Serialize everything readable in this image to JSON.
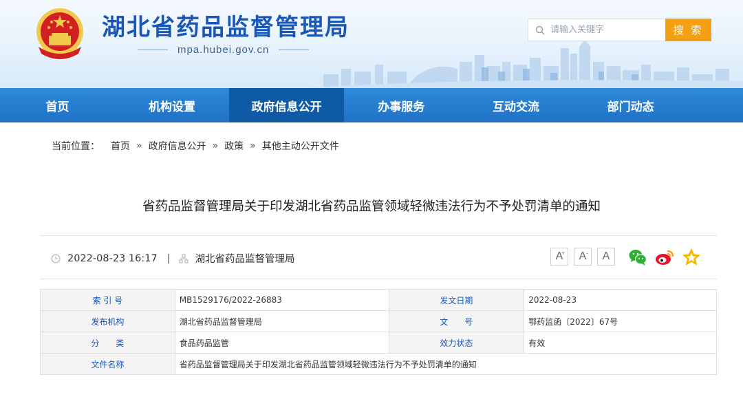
{
  "header": {
    "site_title": "湖北省药品监督管理局",
    "domain": "mpa.hubei.gov.cn",
    "search_placeholder": "请输入关键字",
    "search_button": "搜 索"
  },
  "nav": {
    "items": [
      {
        "label": "首页"
      },
      {
        "label": "机构设置"
      },
      {
        "label": "政府信息公开",
        "active": true
      },
      {
        "label": "办事服务"
      },
      {
        "label": "互动交流"
      },
      {
        "label": "部门动态"
      }
    ]
  },
  "breadcrumb": {
    "prefix": "当前位置：",
    "items": [
      "首页",
      "政府信息公开",
      "政策",
      "其他主动公开文件"
    ],
    "separator": "»"
  },
  "article": {
    "title": "省药品监督管理局关于印发湖北省药品监管领域轻微违法行为不予处罚清单的通知",
    "datetime": "2022-08-23 16:17",
    "meta_separator": "|",
    "source": "湖北省药品监督管理局",
    "font_buttons": [
      "A",
      "A",
      "A"
    ],
    "font_increase_sup": "+",
    "font_decrease_sup": "-"
  },
  "info": {
    "index_label": "索 引 号",
    "index_value": "MB1529176/2022-26883",
    "date_label": "发文日期",
    "date_value": "2022-08-23",
    "publisher_label": "发布机构",
    "publisher_value": "湖北省药品监督管理局",
    "docno_label": "文　　号",
    "docno_value": "鄂药监函〔2022〕67号",
    "category_label": "分　　类",
    "category_value": "食品药品监管",
    "validity_label": "效力状态",
    "validity_value": "有效",
    "filename_label": "文件名称",
    "filename_value": "省药品监督管理局关于印发湖北省药品监管领域轻微违法行为不予处罚清单的通知"
  },
  "colors": {
    "brand_blue": "#1a56b8",
    "nav_blue": "#2f89da",
    "nav_active": "#0f5aa6",
    "search_orange": "#f4a015"
  },
  "icons": {
    "emblem": "national-emblem",
    "search": "search-icon",
    "clock": "clock-icon",
    "org": "org-icon",
    "wechat": "wechat-icon",
    "weibo": "weibo-icon",
    "favorite": "star-icon"
  }
}
